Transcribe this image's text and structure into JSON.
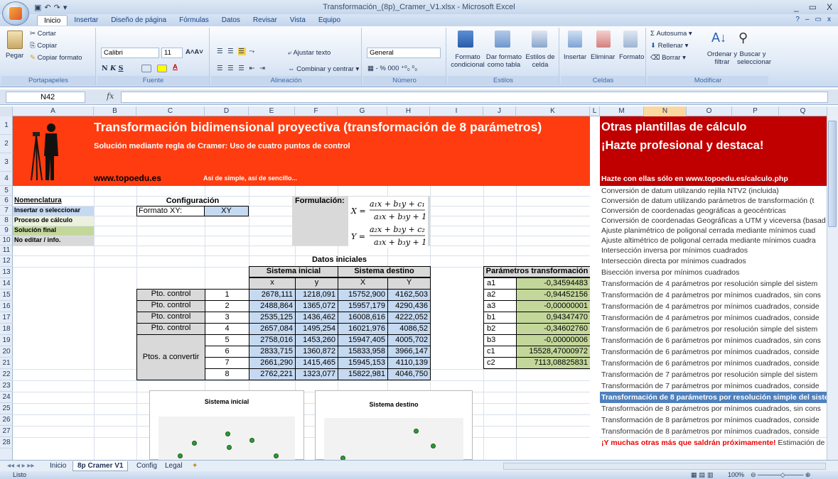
{
  "window": {
    "title": "Transformación_(8p)_Cramer_V1.xlsx - Microsoft Excel",
    "controls": [
      "_",
      "▭",
      "X"
    ]
  },
  "ribbon_tabs": [
    "Inicio",
    "Insertar",
    "Diseño de página",
    "Fórmulas",
    "Datos",
    "Revisar",
    "Vista",
    "Equipo"
  ],
  "ribbon": {
    "portapapeles": {
      "label": "Portapapeles",
      "pegar": "Pegar",
      "cortar": "Cortar",
      "copiar": "Copiar",
      "copiar_formato": "Copiar formato"
    },
    "fuente": {
      "label": "Fuente",
      "font": "Calibri",
      "size": "11"
    },
    "alineacion": {
      "label": "Alineación",
      "ajustar": "Ajustar texto",
      "combinar": "Combinar y centrar"
    },
    "numero": {
      "label": "Número",
      "format": "General"
    },
    "estilos": {
      "label": "Estilos",
      "condicional": "Formato condicional",
      "como_tabla": "Dar formato como tabla",
      "estilos_celda": "Estilos de celda"
    },
    "celdas": {
      "label": "Celdas",
      "insertar": "Insertar",
      "eliminar": "Eliminar",
      "formato": "Formato"
    },
    "modificar": {
      "label": "Modificar",
      "autosuma": "Autosuma",
      "rellenar": "Rellenar",
      "borrar": "Borrar",
      "ordenar": "Ordenar y filtrar",
      "buscar": "Buscar y seleccionar"
    }
  },
  "formula_bar": {
    "name_box": "N42",
    "fx": "fx",
    "value": ""
  },
  "columns": [
    "A",
    "B",
    "C",
    "D",
    "E",
    "F",
    "G",
    "H",
    "I",
    "J",
    "K",
    "L",
    "M",
    "N",
    "O",
    "P",
    "Q"
  ],
  "rows": [
    "1",
    "2",
    "3",
    "4",
    "5",
    "6",
    "7",
    "8",
    "9",
    "10",
    "11",
    "12",
    "13",
    "14",
    "15",
    "16",
    "17",
    "18",
    "19",
    "20",
    "21",
    "22",
    "23",
    "24",
    "25",
    "26",
    "27",
    "28"
  ],
  "banner": {
    "title": "Transformación bidimensional proyectiva (transformación de 8 parámetros)",
    "subtitle": "Solución mediante regla de Cramer: Uso de cuatro puntos de control",
    "site": "www.topoedu.es",
    "tagline": "Así de simple, así de sencillo..."
  },
  "legend": {
    "title": "Nomenclatura",
    "items": [
      {
        "label": "Insertar o seleccionar",
        "color": "#c5d9f1"
      },
      {
        "label": "Proceso de cálculo",
        "color": "#ebf1de"
      },
      {
        "label": "Solución final",
        "color": "#c4d79b"
      },
      {
        "label": "No editar / info.",
        "color": "#d9d9d9"
      }
    ]
  },
  "config": {
    "title": "Configuración",
    "label": "Formato XY:",
    "value": "XY"
  },
  "formulacion": {
    "label": "Formulación:"
  },
  "datos": {
    "title": "Datos iniciales",
    "sistema_inicial": "Sistema inicial",
    "sistema_destino": "Sistema destino",
    "cols": [
      "x",
      "y",
      "X",
      "Y"
    ],
    "control_label": "Pto. control",
    "convert_label": "Ptos. a convertir",
    "rows": [
      {
        "n": "1",
        "x": "2678,111",
        "y": "1218,091",
        "X": "15752,900",
        "Y": "4162,503"
      },
      {
        "n": "2",
        "x": "2488,864",
        "y": "1365,072",
        "X": "15957,179",
        "Y": "4290,436"
      },
      {
        "n": "3",
        "x": "2535,125",
        "y": "1436,462",
        "X": "16008,616",
        "Y": "4222,052"
      },
      {
        "n": "4",
        "x": "2657,084",
        "y": "1495,254",
        "X": "16021,976",
        "Y": "4086,52"
      },
      {
        "n": "5",
        "x": "2758,016",
        "y": "1453,260",
        "X": "15947,405",
        "Y": "4005,702"
      },
      {
        "n": "6",
        "x": "2833,715",
        "y": "1360,872",
        "X": "15833,958",
        "Y": "3966,147"
      },
      {
        "n": "7",
        "x": "2661,290",
        "y": "1415,465",
        "X": "15945,153",
        "Y": "4110,139"
      },
      {
        "n": "8",
        "x": "2762,221",
        "y": "1323,077",
        "X": "15822,981",
        "Y": "4046,750"
      }
    ]
  },
  "params": {
    "title": "Parámetros transformación",
    "rows": [
      {
        "k": "a1",
        "v": "-0,34594483"
      },
      {
        "k": "a2",
        "v": "-0,94452156"
      },
      {
        "k": "a3",
        "v": "-0,00000001"
      },
      {
        "k": "b1",
        "v": "0,94347470"
      },
      {
        "k": "b2",
        "v": "-0,34602760"
      },
      {
        "k": "b3",
        "v": "-0,00000006"
      },
      {
        "k": "c1",
        "v": "15528,47000972"
      },
      {
        "k": "c2",
        "v": "7113,08825831"
      }
    ]
  },
  "promo": {
    "line1": "Otras plantillas de cálculo",
    "line2": "¡Hazte profesional y destaca!",
    "line3_prefix": "Hazte con ellas sólo en ",
    "line3_link": "www.topoedu.es/calculo.php",
    "items": [
      "Conversión de datum utilizando rejilla NTV2 (incluida)",
      "Conversión de datum utilizando parámetros de transformación (t",
      "Conversión de coordenadas geográficas a geocéntricas",
      "Conversión de coordenadas Geográficas a UTM y viceversa (basad",
      "Ajuste planimétrico de poligonal cerrada mediante mínimos cuad",
      "Ajuste altimétrico de poligonal cerrada mediante mínimos cuadra",
      "Intersección inversa por mínimos cuadrados",
      "Intersección directa por mínimos cuadrados",
      "Bisección inversa por mínimos cuadrados",
      "Transformación de 4 parámetros por resolución simple del sistem",
      "Transformación de 4 parámetros por mínimos cuadrados, sin cons",
      "Transformación de 4 parámetros por mínimos cuadrados, conside",
      "Transformación de 4 parámetros por mínimos cuadrados, conside",
      "Transformación de 6 parámetros por resolución simple del sistem",
      "Transformación de 6 parámetros por mínimos cuadrados, sin cons",
      "Transformación de 6 parámetros por mínimos cuadrados, conside",
      "Transformación de 6 parámetros por mínimos cuadrados, conside",
      "Transformación de 7 parámetros por resolución simple del sistem",
      "Transformación de 7 parámetros por mínimos cuadrados, conside",
      "Transformación de 8 parámetros por resolución simple del sistem",
      "Transformación de 8 parámetros por mínimos cuadrados, sin cons",
      "Transformación de 8 parámetros por mínimos cuadrados, conside",
      "Transformación de 8 parámetros por mínimos cuadrados, conside"
    ],
    "highlight_index": 19,
    "last_red": "¡Y muchas otras más que saldrán próximamente!",
    "last_rest": " Estimación de la"
  },
  "charts": {
    "inicial_title": "Sistema inicial",
    "destino_title": "Sistema destino"
  },
  "sheet_tabs": [
    "Inicio",
    "8p Cramer V1",
    "Config",
    "Legal"
  ],
  "status": {
    "ready": "Listo",
    "zoom": "100%"
  }
}
